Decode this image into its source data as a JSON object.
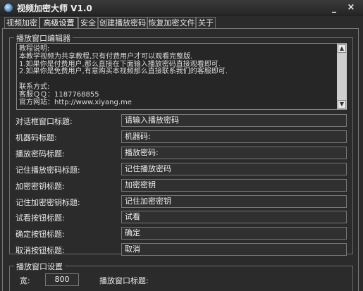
{
  "window": {
    "title": "视频加密大师 V1.0",
    "minimize": "_",
    "close": "×"
  },
  "tabs": [
    "视频加密",
    "高级设置",
    "安全",
    "创建播放密码",
    "恢复加密文件",
    "关于"
  ],
  "editor": {
    "group_title": "播放窗口编辑器",
    "memo_lines": [
      "教程说明:",
      "本教学视频为共享教程,只有付费用户才可以观看完整版.",
      "1.如果你是付费用户,那么直接在下面输入播放密码直接观看即可.",
      "2.如果你是免费用户,有意购买本视频那么直接联系我们的客服即可.",
      "",
      "联系方式:",
      "客服ＱＱ：1187768855",
      "官方网站：http://www.xiyang.me"
    ],
    "scroll_up": "▲",
    "scroll_down": "▼",
    "fields": [
      {
        "label": "对话框窗口标题:",
        "value": "请输入播放密码"
      },
      {
        "label": "机器码标题:",
        "value": "机器码:"
      },
      {
        "label": "播放密码标题:",
        "value": "播放密码:"
      },
      {
        "label": "记住播放密码标题:",
        "value": "记住播放密码"
      },
      {
        "label": "加密密钥标题:",
        "value": "加密密钥"
      },
      {
        "label": "记住加密密钥标题:",
        "value": "记住加密密钥"
      },
      {
        "label": "试看按钮标题:",
        "value": "试看"
      },
      {
        "label": "确定按钮标题:",
        "value": "确定"
      },
      {
        "label": "取消按钮标题:",
        "value": "取消"
      }
    ]
  },
  "player": {
    "group_title": "播放窗口设置",
    "width_label": "宽:",
    "width_value": "800",
    "title_label": "播放窗口标题:"
  }
}
